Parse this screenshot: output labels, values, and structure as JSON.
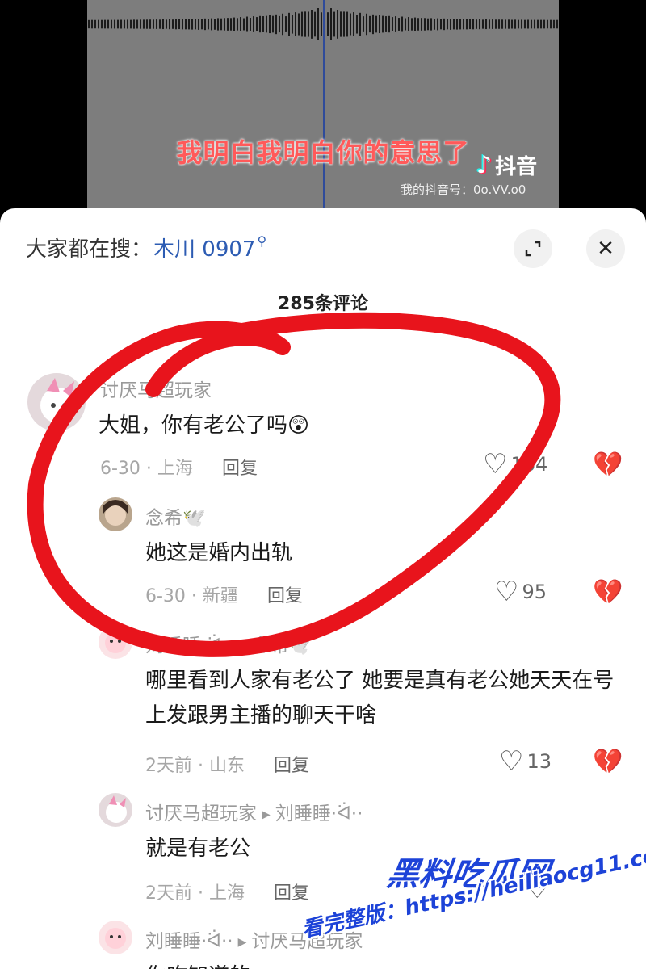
{
  "video": {
    "subtitle": "我明白我明白你的意思了",
    "brand": "抖音",
    "account_label": "我的抖音号：0o.VV.o0"
  },
  "search": {
    "prefix": "大家都在搜：",
    "term": "木川 0907"
  },
  "comments_count": "285条评论",
  "comments": [
    {
      "user": "讨厌马超玩家",
      "text": "大姐，你有老公了吗😲",
      "date": "6-30",
      "location": "上海",
      "reply_label": "回复",
      "likes": "164"
    },
    {
      "user": "念希🕊️",
      "text": "她这是婚内出轨",
      "date": "6-30",
      "location": "新疆",
      "reply_label": "回复",
      "likes": "95"
    },
    {
      "user": "刘睡睡·ᐛ··",
      "reply_to": "念希🕊️",
      "text": "哪里看到人家有老公了 她要是真有老公她天天在号上发跟男主播的聊天干啥",
      "date": "2天前",
      "location": "山东",
      "reply_label": "回复",
      "likes": "13"
    },
    {
      "user": "讨厌马超玩家",
      "reply_to": "刘睡睡·ᐛ··",
      "text": "就是有老公",
      "date": "2天前",
      "location": "上海",
      "reply_label": "回复",
      "likes": ""
    },
    {
      "user": "刘睡睡·ᐛ··",
      "reply_to": "讨厌马超玩家",
      "text": "你咋知道的",
      "date": "",
      "location": "",
      "reply_label": "",
      "likes": ""
    }
  ],
  "watermark": {
    "logo": "黑料吃瓜网",
    "url": "看完整版：https://heiliaocg11.com"
  },
  "colors": {
    "accent_blue": "#2d5cb3",
    "annotation_red": "#e8141c",
    "watermark_blue": "#1d43d8"
  }
}
